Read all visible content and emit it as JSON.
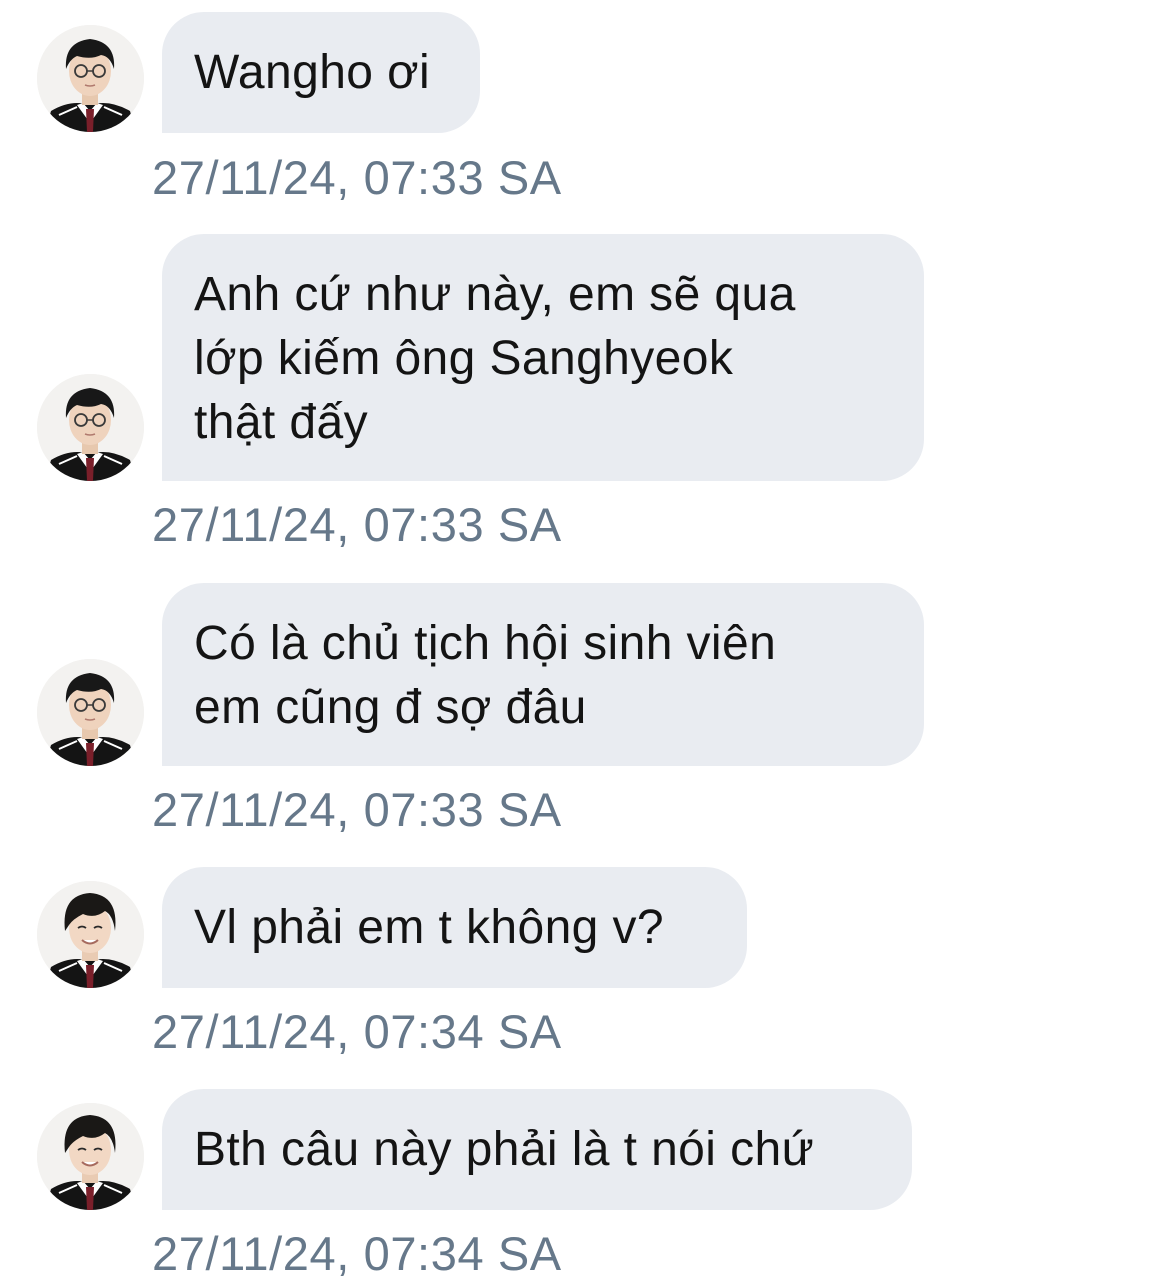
{
  "conversation": {
    "messages": [
      {
        "sender_avatar": "glasses-boy-avatar",
        "text": "Wangho ơi",
        "time": "27/11/24, 07:33 SA"
      },
      {
        "sender_avatar": "glasses-boy-avatar",
        "text": "Anh cứ như này, em sẽ qua\nlớp kiếm ông Sanghyeok\nthật đấy",
        "time": "27/11/24, 07:33 SA"
      },
      {
        "sender_avatar": "glasses-boy-avatar",
        "text": "Có là chủ tịch hội sinh viên\nem cũng đ sợ đâu",
        "time": "27/11/24, 07:33 SA"
      },
      {
        "sender_avatar": "smiling-boy-avatar",
        "text": "Vl phải em t không v?",
        "time": "27/11/24, 07:34 SA"
      },
      {
        "sender_avatar": "smiling-boy-avatar",
        "text": "Bth câu này phải là t nói chứ",
        "time": "27/11/24, 07:34 SA"
      }
    ]
  },
  "colors": {
    "bubble_background": "#e9ecf1",
    "message_text": "#141414",
    "timestamp_text": "#66788a",
    "page_background": "#ffffff"
  }
}
